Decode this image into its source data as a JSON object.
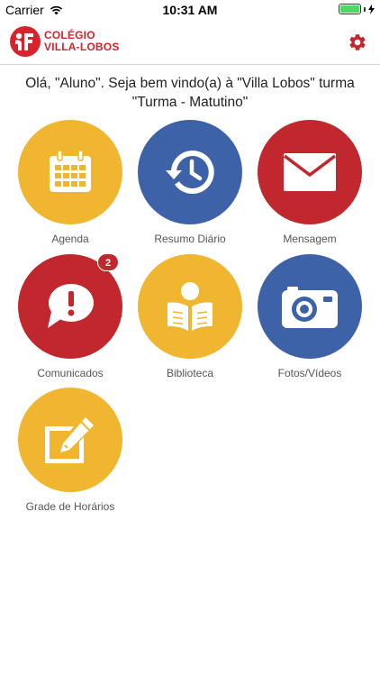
{
  "status_bar": {
    "carrier": "Carrier",
    "time": "10:31 AM"
  },
  "header": {
    "logo_line1": "COLÉGIO",
    "logo_line2": "VILLA-LOBOS",
    "brand_color": "#d7232b"
  },
  "welcome_text": "Olá, \"Aluno\". Seja bem vindo(a) à \"Villa Lobos\" turma \"Turma - Matutino\"",
  "colors": {
    "yellow": "#f0b630",
    "blue": "#3e62a7",
    "red": "#c0282e"
  },
  "tiles": [
    {
      "label": "Agenda",
      "color": "#f0b630",
      "icon": "calendar-icon"
    },
    {
      "label": "Resumo Diário",
      "color": "#3e62a7",
      "icon": "history-icon"
    },
    {
      "label": "Mensagem",
      "color": "#c0282e",
      "icon": "envelope-icon"
    },
    {
      "label": "Comunicados",
      "color": "#c0282e",
      "icon": "exclamation-bubble-icon",
      "badge": "2"
    },
    {
      "label": "Biblioteca",
      "color": "#f0b630",
      "icon": "reader-icon"
    },
    {
      "label": "Fotos/Vídeos",
      "color": "#3e62a7",
      "icon": "camera-icon"
    },
    {
      "label": "Grade de Horários",
      "color": "#f0b630",
      "icon": "edit-icon"
    }
  ]
}
